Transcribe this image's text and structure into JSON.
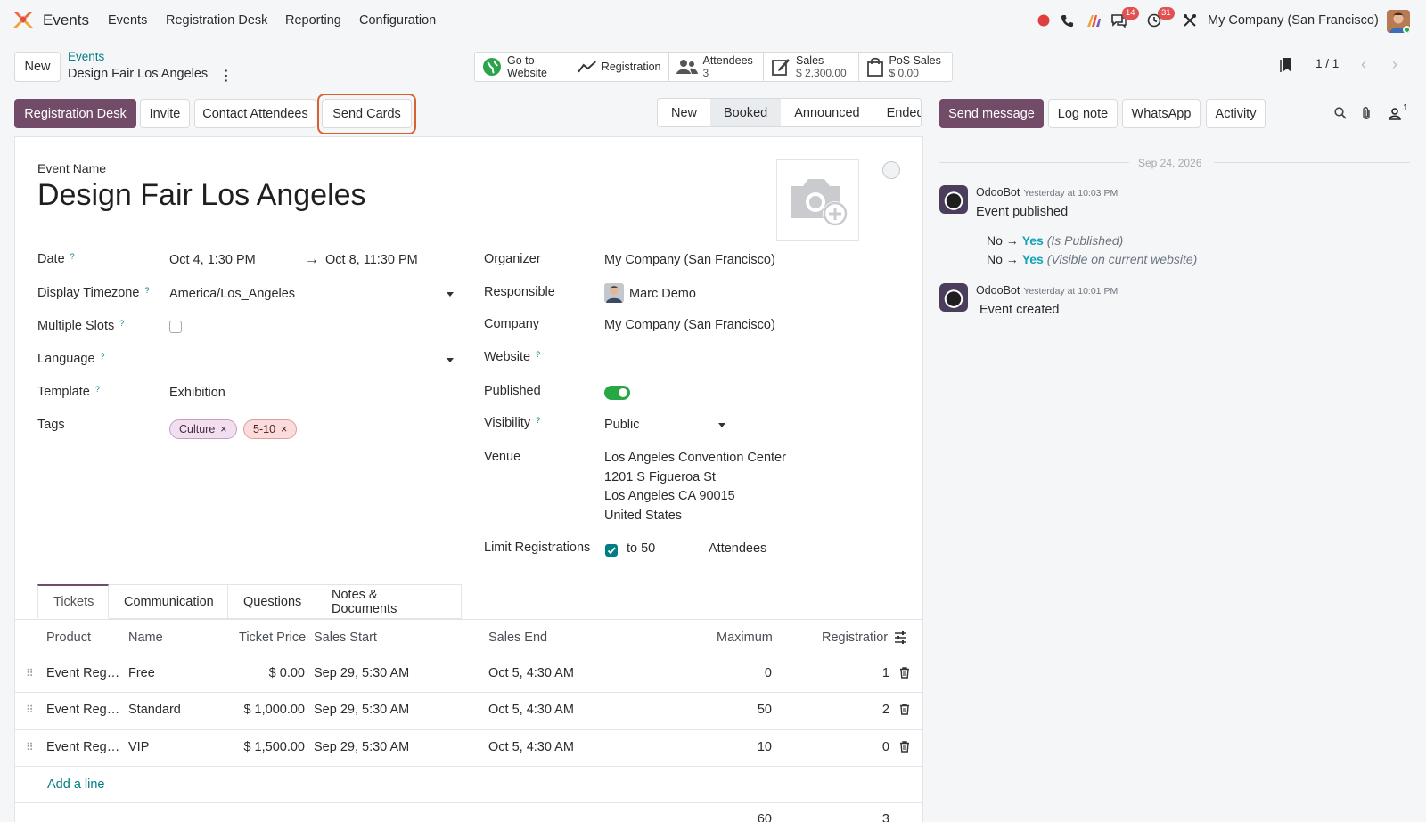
{
  "navbar": {
    "brand": "Events",
    "menu": [
      "Events",
      "Registration Desk",
      "Reporting",
      "Configuration"
    ],
    "badges": {
      "messages": "14",
      "activities": "31"
    },
    "company": "My Company (San Francisco)"
  },
  "control": {
    "new_label": "New",
    "breadcrumb": "Events",
    "record": "Design Fair Los Angeles",
    "smart_buttons": [
      {
        "l1": "Go to",
        "l2": "Website",
        "icon": "globe-icon"
      },
      {
        "l1": "Registration",
        "l2": "",
        "icon": "chart-line-icon"
      },
      {
        "l1": "Attendees",
        "l2": "3",
        "icon": "users-icon"
      },
      {
        "l1": "Sales",
        "l2": "$ 2,300.00",
        "icon": "edit-icon"
      },
      {
        "l1": "PoS Sales",
        "l2": "$ 0.00",
        "icon": "shopping-bag-icon"
      }
    ],
    "pager": "1 / 1"
  },
  "actions": {
    "registration_desk": "Registration Desk",
    "invite": "Invite",
    "contact_attendees": "Contact Attendees",
    "send_cards": "Send Cards"
  },
  "statusbar": [
    "New",
    "Booked",
    "Announced",
    "Ended"
  ],
  "statusbar_active": "Booked",
  "chatter_buttons": {
    "send_message": "Send message",
    "log_note": "Log note",
    "whatsapp": "WhatsApp",
    "activity": "Activity",
    "followers": "1"
  },
  "form": {
    "event_name_label": "Event Name",
    "event_name": "Design Fair Los Angeles",
    "left": {
      "date_label": "Date",
      "date_start": "Oct 4, 1:30 PM",
      "date_end": "Oct 8, 11:30 PM",
      "tz_label": "Display Timezone",
      "tz_value": "America/Los_Angeles",
      "slots_label": "Multiple Slots",
      "language_label": "Language",
      "template_label": "Template",
      "template_value": "Exhibition",
      "tags_label": "Tags",
      "tags": [
        "Culture",
        "5-10"
      ]
    },
    "right": {
      "organizer_label": "Organizer",
      "organizer_value": "My Company (San Francisco)",
      "responsible_label": "Responsible",
      "responsible_value": "Marc Demo",
      "company_label": "Company",
      "company_value": "My Company (San Francisco)",
      "website_label": "Website",
      "published_label": "Published",
      "visibility_label": "Visibility",
      "visibility_value": "Public",
      "venue_label": "Venue",
      "venue_lines": [
        "Los Angeles Convention Center",
        "1201 S Figueroa St",
        "Los Angeles CA 90015",
        "United States"
      ],
      "limit_label": "Limit Registrations",
      "limit_to": "to 50",
      "limit_unit": "Attendees"
    }
  },
  "tabs": [
    "Tickets",
    "Communication",
    "Questions",
    "Notes & Documents"
  ],
  "tickets": {
    "headers": [
      "Product",
      "Name",
      "Ticket Price",
      "Sales Start",
      "Sales End",
      "Maximum",
      "Registratior"
    ],
    "rows": [
      {
        "product": "Event Reg…",
        "name": "Free",
        "price": "$ 0.00",
        "start": "Sep 29, 5:30 AM",
        "end": "Oct 5, 4:30 AM",
        "max": "0",
        "reg": "1"
      },
      {
        "product": "Event Reg…",
        "name": "Standard",
        "price": "$ 1,000.00",
        "start": "Sep 29, 5:30 AM",
        "end": "Oct 5, 4:30 AM",
        "max": "50",
        "reg": "2"
      },
      {
        "product": "Event Reg…",
        "name": "VIP",
        "price": "$ 1,500.00",
        "start": "Sep 29, 5:30 AM",
        "end": "Oct 5, 4:30 AM",
        "max": "10",
        "reg": "0"
      }
    ],
    "add_line": "Add a line",
    "total_max": "60",
    "total_reg": "3"
  },
  "chatter": {
    "date": "Sep 24, 2026",
    "messages": [
      {
        "author": "OdooBot",
        "time": "Yesterday at 10:03 PM",
        "body": "Event published",
        "tracking": [
          {
            "old": "No",
            "new": "Yes",
            "field": "(Is Published)"
          },
          {
            "old": "No",
            "new": "Yes",
            "field": "(Visible on current website)"
          }
        ]
      },
      {
        "author": "OdooBot",
        "time": "Yesterday at 10:01 PM",
        "body": "Event created"
      }
    ]
  },
  "colors": {
    "primary": "#714b67",
    "accent": "#017e84",
    "highlight": "#d9612f",
    "success": "#28a745"
  }
}
